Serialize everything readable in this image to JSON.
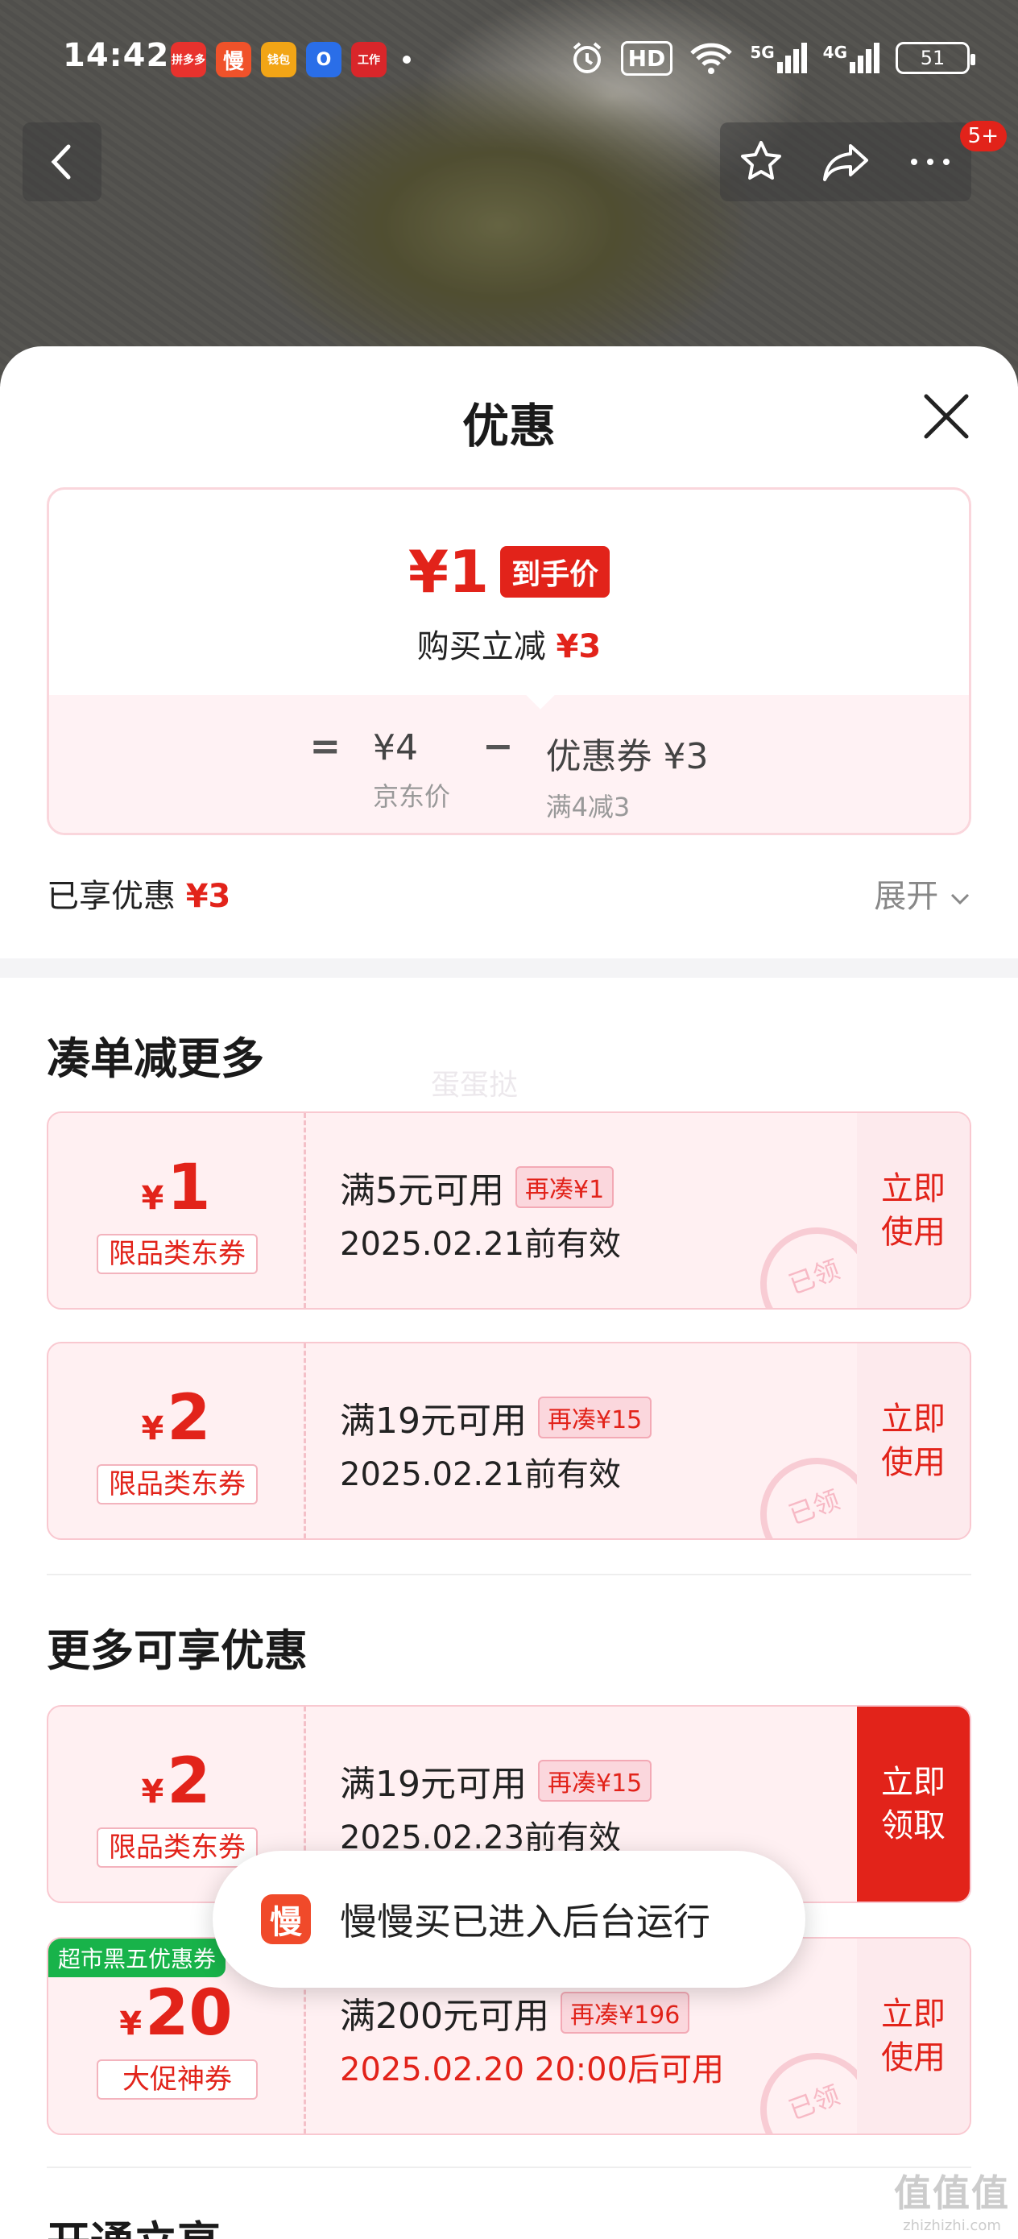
{
  "status_bar": {
    "time": "14:42",
    "app_icons": [
      "拼多多",
      "慢",
      "钱包",
      "O",
      "工作"
    ],
    "hd_label": "HD",
    "network_5g": "5G",
    "network_4g": "4G",
    "battery": "51"
  },
  "header": {
    "notification_badge": "5+"
  },
  "sheet": {
    "title": "优惠",
    "price_box": {
      "final_price": "¥1",
      "final_price_tag": "到手价",
      "reduce_label": "购买立减",
      "reduce_amount": "¥3",
      "formula": {
        "equals": "=",
        "base_price": "¥4",
        "base_label": "京东价",
        "minus": "−",
        "coupon_value": "优惠券 ¥3",
        "coupon_rule": "满4减3"
      }
    },
    "enjoyed_label": "已享优惠",
    "enjoyed_amount": "¥3",
    "expand_label": "展开"
  },
  "section_more_orders": {
    "title": "凑单减更多",
    "watermark": "蛋蛋挞"
  },
  "section_more_discounts": {
    "title": "更多可享优惠"
  },
  "coupons": [
    {
      "currency": "¥",
      "amount": "1",
      "type": "限品类东券",
      "condition": "满5元可用",
      "gap": "再凑¥1",
      "validity": "2025.02.21前有效",
      "button": "立即\n使用",
      "stamp": "已领"
    },
    {
      "currency": "¥",
      "amount": "2",
      "type": "限品类东券",
      "condition": "满19元可用",
      "gap": "再凑¥15",
      "validity": "2025.02.21前有效",
      "button": "立即\n使用",
      "stamp": "已领"
    },
    {
      "currency": "¥",
      "amount": "2",
      "type": "限品类东券",
      "condition": "满19元可用",
      "gap": "再凑¥15",
      "validity": "2025.02.23前有效",
      "button": "立即\n领取"
    },
    {
      "currency": "¥",
      "amount": "20",
      "type": "大促神券",
      "promo_tag": "超市黑五优惠券",
      "condition": "满200元可用",
      "gap": "再凑¥196",
      "validity": "2025.02.20 20:00后可用",
      "button": "立即\n使用",
      "stamp": "已领"
    }
  ],
  "toast": {
    "icon_char": "慢",
    "text": "慢慢买已进入后台运行"
  },
  "bottom_section_title": "开通立享",
  "corner_watermark": {
    "big": "值值值",
    "small": "zhizhizhi.com"
  },
  "colors": {
    "accent_red": "#e2231a",
    "coupon_bg": "#fff0f2",
    "promo_green": "#18b34a"
  }
}
